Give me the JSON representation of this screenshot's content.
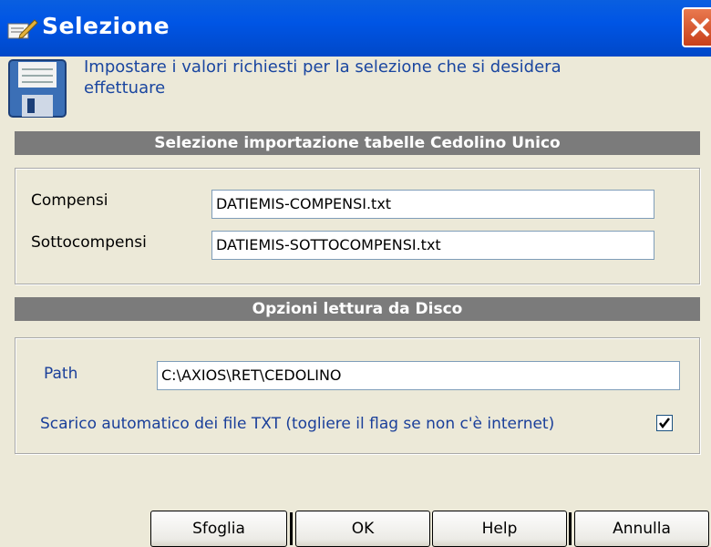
{
  "window": {
    "title": "Selezione",
    "close_icon": "close-icon",
    "app_icon": "edit-icon"
  },
  "header": {
    "icon": "floppy-disk-icon",
    "text_line1": "Impostare i valori richiesti per la selezione che si desidera",
    "text_line2": "effettuare"
  },
  "section_import": {
    "title": "Selezione importazione tabelle Cedolino Unico",
    "compensi_label": "Compensi",
    "compensi_value": "DATIEMIS-COMPENSI.txt",
    "sottocompensi_label": "Sottocompensi",
    "sottocompensi_value": "DATIEMIS-SOTTOCOMPENSI.txt"
  },
  "section_disk": {
    "title": "Opzioni lettura da Disco",
    "path_label": "Path",
    "path_value": "C:\\AXIOS\\RET\\CEDOLINO",
    "auto_download_label": "Scarico automatico dei file TXT (togliere il flag se non c'è internet)",
    "auto_download_checked": true
  },
  "buttons": {
    "browse": "Sfoglia",
    "ok": "OK",
    "help": "Help",
    "cancel": "Annulla"
  },
  "colors": {
    "titlebar": "#0055e5",
    "section_bar": "#7b7b7b",
    "info_text": "#1a46a0",
    "label_blue": "#1a3f9a"
  }
}
